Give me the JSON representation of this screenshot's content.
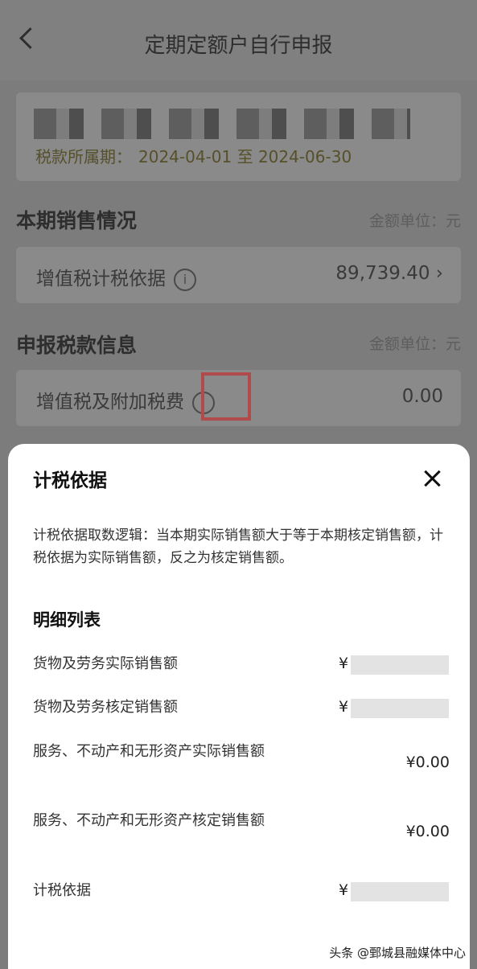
{
  "header": {
    "title": "定期定额户自行申报"
  },
  "period": {
    "label": "税款所属期：",
    "value": "2024-04-01 至 2024-06-30"
  },
  "sales_section": {
    "title": "本期销售情况",
    "unit": "金额单位：元"
  },
  "sales_row": {
    "label": "增值税计税依据",
    "value": "89,739.40 ›"
  },
  "tax_section": {
    "title": "申报税款信息",
    "unit": "金额单位：元"
  },
  "tax_row": {
    "label": "增值税及附加税费",
    "value": "0.00"
  },
  "sheet": {
    "title": "计税依据",
    "description": "计税依据取数逻辑：当本期实际销售额大于等于本期核定销售额，计税依据为实际销售额，反之为核定销售额。",
    "list_title": "明细列表",
    "items": [
      {
        "label": "货物及劳务实际销售额",
        "currency": "¥",
        "value": ""
      },
      {
        "label": "货物及劳务核定销售额",
        "currency": "¥",
        "value": ""
      },
      {
        "label": "服务、不动产和无形资产实际销售额",
        "currency": "",
        "value": "¥0.00"
      },
      {
        "label": "服务、不动产和无形资产核定销售额",
        "currency": "",
        "value": "¥0.00"
      },
      {
        "label": "计税依据",
        "currency": "¥",
        "value": ""
      }
    ]
  },
  "watermark": "头条 @鄄城县融媒体中心"
}
